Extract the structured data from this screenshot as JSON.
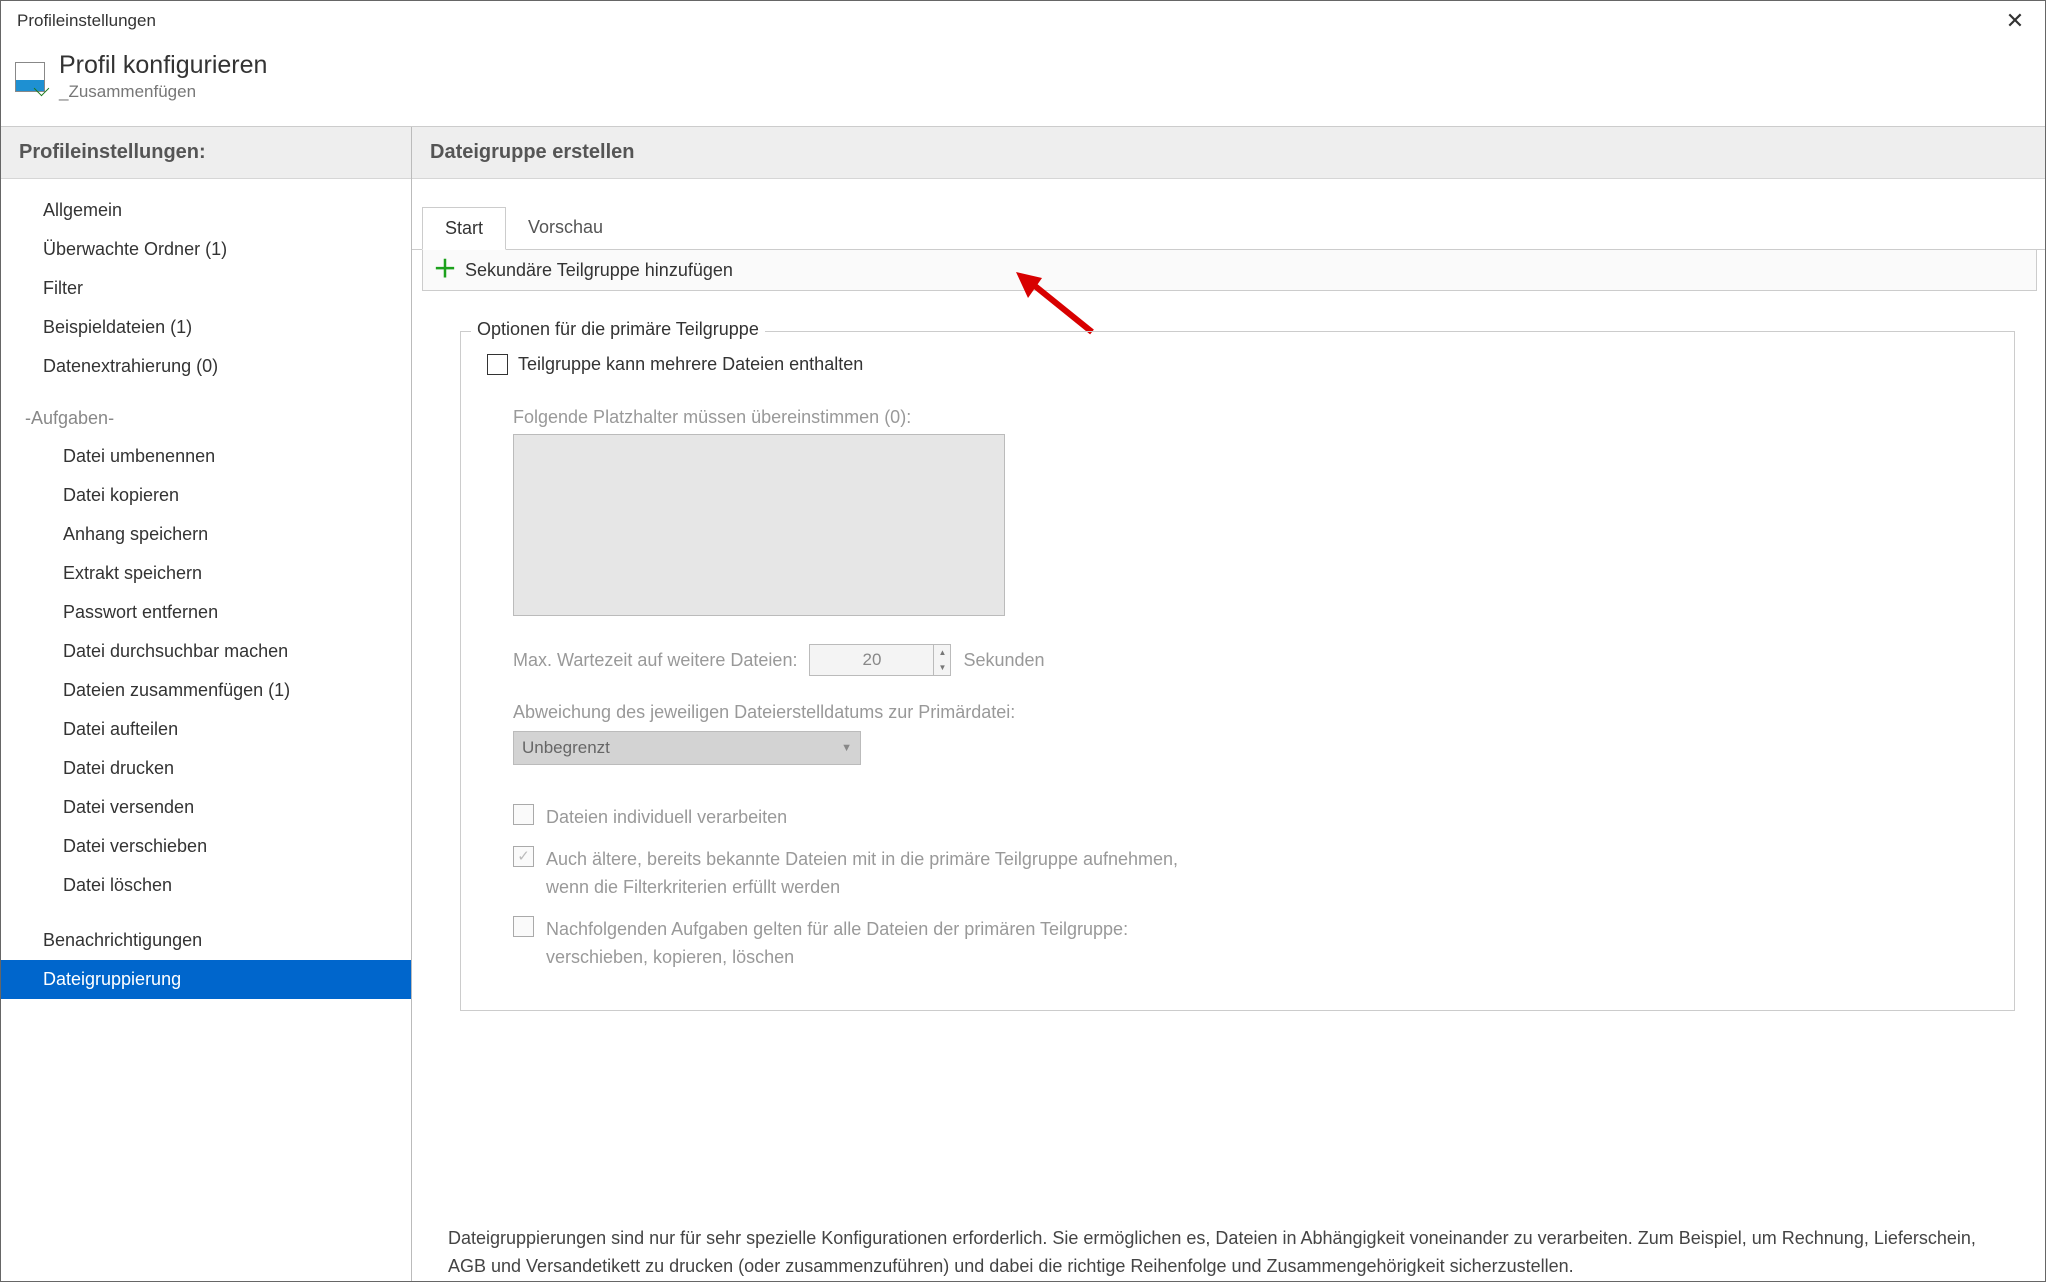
{
  "window": {
    "title": "Profileinstellungen"
  },
  "header": {
    "title": "Profil konfigurieren",
    "subtitle": "_Zusammenfügen"
  },
  "sidebar": {
    "header": "Profileinstellungen:",
    "items": [
      "Allgemein",
      "Überwachte Ordner (1)",
      "Filter",
      "Beispieldateien (1)",
      "Datenextrahierung (0)"
    ],
    "tasks_caption": "-Aufgaben-",
    "tasks": [
      "Datei umbenennen",
      "Datei kopieren",
      "Anhang speichern",
      "Extrakt speichern",
      "Passwort entfernen",
      "Datei durchsuchbar machen",
      "Dateien zusammenfügen (1)",
      "Datei aufteilen",
      "Datei drucken",
      "Datei versenden",
      "Datei verschieben",
      "Datei löschen"
    ],
    "footer": [
      "Benachrichtigungen",
      "Dateigruppierung"
    ],
    "selected": "Dateigruppierung"
  },
  "main": {
    "header": "Dateigruppe erstellen",
    "tabs": {
      "start": "Start",
      "preview": "Vorschau"
    },
    "add_button": "Sekundäre Teilgruppe hinzufügen",
    "fieldset_legend": "Optionen für die primäre Teilgruppe",
    "chk_multifile": "Teilgruppe kann mehrere Dateien enthalten",
    "placeholder_caption": "Folgende Platzhalter müssen übereinstimmen (0):",
    "wait_label": "Max. Wartezeit auf weitere Dateien:",
    "wait_value": "20",
    "wait_unit": "Sekunden",
    "deviation_label": "Abweichung des jeweiligen Dateierstelldatums zur Primärdatei:",
    "deviation_value": "Unbegrenzt",
    "opt_individual": "Dateien individuell verarbeiten",
    "opt_older_line1": "Auch ältere, bereits bekannte Dateien mit in die primäre Teilgruppe aufnehmen,",
    "opt_older_line2": "wenn die Filterkriterien erfüllt werden",
    "opt_following_line1": "Nachfolgenden Aufgaben gelten für alle Dateien der primären Teilgruppe:",
    "opt_following_line2": "verschieben, kopieren, löschen",
    "footer_note": "Dateigruppierungen sind nur für sehr spezielle Konfigurationen erforderlich. Sie ermöglichen es, Dateien in Abhängigkeit voneinander zu verarbeiten. Zum Beispiel, um Rechnung, Lieferschein, AGB und Versandetikett zu drucken (oder zusammenzuführen) und dabei die richtige Reihenfolge und Zusammengehörigkeit sicherzustellen."
  }
}
